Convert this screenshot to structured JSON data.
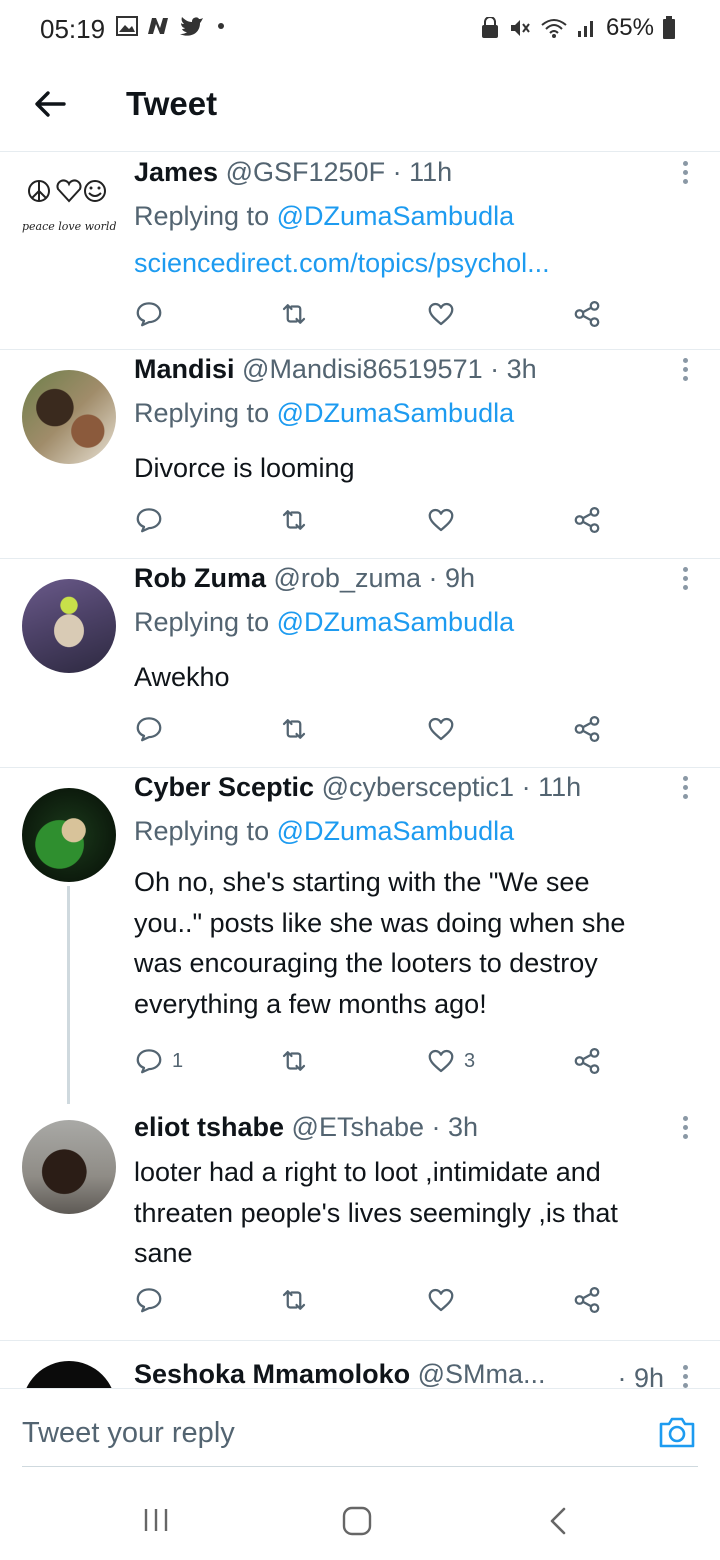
{
  "status_bar": {
    "time": "05:19",
    "battery": "65%",
    "left_icons": [
      "gallery-icon",
      "n-app-icon",
      "twitter-bird-icon",
      "dot-icon"
    ],
    "right_icons": [
      "lock-icon",
      "mute-icon",
      "wifi-icon",
      "signal-icon",
      "battery-icon"
    ]
  },
  "header": {
    "title": "Tweet"
  },
  "tweets": [
    {
      "name": "James",
      "handle": "@GSF1250F",
      "time": "· 11h",
      "replying_label": "Replying to",
      "replying_to": "@DZumaSambudla",
      "link": "sciencedirect.com/topics/psychol...",
      "avatar_text": "peace love world",
      "replies": "",
      "likes": ""
    },
    {
      "name": "Mandisi",
      "handle": "@Mandisi86519571",
      "time": "· 3h",
      "replying_label": "Replying to",
      "replying_to": "@DZumaSambudla",
      "text": "Divorce is looming",
      "replies": "",
      "likes": ""
    },
    {
      "name": "Rob Zuma",
      "handle": "@rob_zuma",
      "time": "· 9h",
      "replying_label": "Replying to",
      "replying_to": "@DZumaSambudla",
      "text": "Awekho",
      "replies": "",
      "likes": ""
    },
    {
      "name": "Cyber Sceptic",
      "handle": "@cybersceptic1",
      "time": "· 11h",
      "replying_label": "Replying to",
      "replying_to": "@DZumaSambudla",
      "text_lines": [
        "Oh no, she's starting with the \"We see",
        "you..\" posts like she was doing when she",
        "was encouraging the looters to destroy",
        "everything a few months ago!"
      ],
      "replies": "1",
      "likes": "3"
    },
    {
      "name": "eliot tshabe",
      "handle": "@ETshabe",
      "time": "· 3h",
      "text_lines": [
        "looter had a right to loot ,intimidate and",
        "threaten people's lives seemingly ,is that",
        "sane"
      ],
      "replies": "",
      "likes": ""
    },
    {
      "name": "Seshoka Mmamoloko",
      "handle": "@SMma...",
      "time": "· 9h"
    }
  ],
  "reply_bar": {
    "placeholder": "Tweet your reply"
  },
  "colors": {
    "accent": "#1d9bf0",
    "text": "#0f1419",
    "muted": "#536471",
    "divider": "#e6ecf0"
  }
}
